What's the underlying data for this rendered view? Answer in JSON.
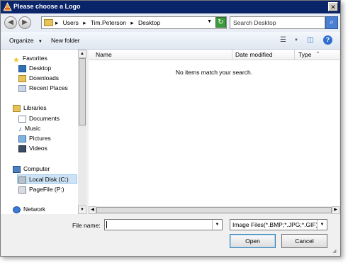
{
  "window": {
    "title": "Please choose a Logo",
    "close_glyph": "✕"
  },
  "navigation": {
    "back_glyph": "◀",
    "forward_glyph": "▶",
    "breadcrumb": [
      "Users",
      "Tim.Peterson",
      "Desktop"
    ],
    "breadcrumb_sep": "▸",
    "address_dropdown_glyph": "▼",
    "refresh_glyph": "↻",
    "search_placeholder": "Search Desktop",
    "search_glyph": "⌕"
  },
  "toolbar": {
    "organize_label": "Organize",
    "organize_caret": "▼",
    "new_folder_label": "New folder",
    "views_glyph": "☰",
    "views_caret": "▼",
    "preview_glyph": "◫",
    "help_glyph": "?"
  },
  "sidebar": {
    "groups": [
      {
        "label": "Favorites",
        "icon": "star-icon",
        "color": "#f2c230",
        "items": [
          {
            "label": "Desktop",
            "icon": "desktop-icon"
          },
          {
            "label": "Downloads",
            "icon": "downloads-icon"
          },
          {
            "label": "Recent Places",
            "icon": "recent-places-icon"
          }
        ]
      },
      {
        "label": "Libraries",
        "icon": "libraries-icon",
        "color": "#e6c25a",
        "items": [
          {
            "label": "Documents",
            "icon": "documents-icon"
          },
          {
            "label": "Music",
            "icon": "music-icon"
          },
          {
            "label": "Pictures",
            "icon": "pictures-icon"
          },
          {
            "label": "Videos",
            "icon": "videos-icon"
          }
        ]
      },
      {
        "label": "Computer",
        "icon": "computer-icon",
        "color": "#4a7fc1",
        "items": [
          {
            "label": "Local Disk (C:)",
            "icon": "local-disk-icon",
            "selected": true
          },
          {
            "label": "PageFile (P:)",
            "icon": "drive-icon"
          }
        ]
      },
      {
        "label": "Network",
        "icon": "network-icon",
        "color": "#3a7bd5",
        "items": []
      }
    ]
  },
  "file_list": {
    "columns": [
      "Name",
      "Date modified",
      "Type"
    ],
    "sort_glyph": "^",
    "empty_message": "No items match your search."
  },
  "scroll": {
    "up": "▲",
    "down": "▼",
    "left": "◀",
    "right": "▶"
  },
  "footer": {
    "file_name_label": "File name:",
    "file_name_value": "",
    "file_name_dropdown": "▼",
    "filter_value": "Image Files(*.BMP;*.JPG;*.GIF)",
    "filter_dropdown": "▼",
    "open_label": "Open",
    "cancel_label": "Cancel",
    "grip_glyph": "◢"
  },
  "colors": {
    "titlebar": "#0a246a",
    "selected_row": "#cde3f5"
  }
}
